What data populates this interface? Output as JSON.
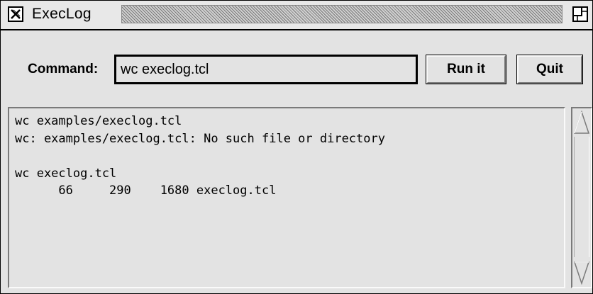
{
  "window": {
    "title": "ExecLog"
  },
  "command": {
    "label": "Command:",
    "value": "wc execlog.tcl"
  },
  "buttons": {
    "run_label": "Run it",
    "quit_label": "Quit"
  },
  "log": {
    "text": "wc examples/execlog.tcl\nwc: examples/execlog.tcl: No such file or directory\n\nwc execlog.tcl\n      66     290    1680 execlog.tcl"
  },
  "icons": {
    "close": "x-close-icon",
    "maximize": "maximize-icon",
    "scroll_up": "triangle-up-icon",
    "scroll_down": "triangle-down-icon"
  },
  "colors": {
    "background": "#e3e3e3",
    "text": "#000000"
  }
}
